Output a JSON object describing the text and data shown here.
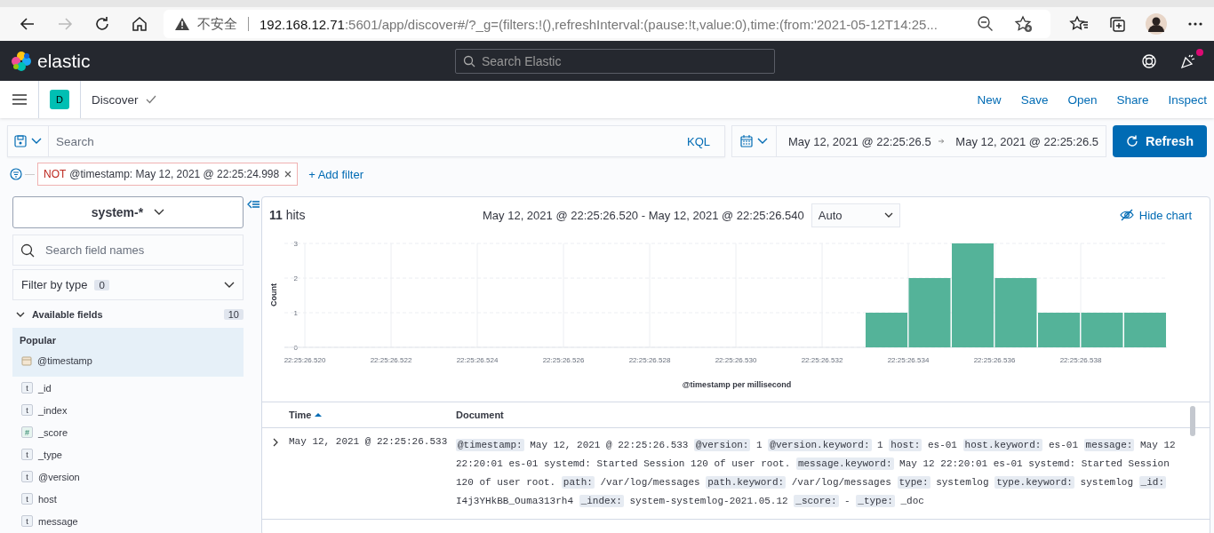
{
  "browser": {
    "security_label": "不安全",
    "address_host": "192.168.12.71",
    "address_rest": ":5601/app/discover#/?_g=(filters:!(),refreshInterval:(pause:!t,value:0),time:(from:'2021-05-12T14:25..."
  },
  "header": {
    "logo": "elastic",
    "search": {
      "placeholder": "Search Elastic"
    },
    "news_unread": true
  },
  "nav": {
    "space": "D",
    "breadcrumb": "Discover",
    "actions": [
      "New",
      "Save",
      "Open",
      "Share",
      "Inspect"
    ]
  },
  "query": {
    "placeholder": "Search",
    "language": "KQL",
    "time_start": "May 12, 2021 @ 22:25:26.5",
    "time_end": "May 12, 2021 @ 22:25:26.5",
    "refresh": "Refresh"
  },
  "filters": [
    {
      "negated": true,
      "prefix": "NOT",
      "label": "@timestamp: May 12, 2021 @ 22:25:24.998"
    }
  ],
  "add_filter": "+ Add filter",
  "sidebar": {
    "index_pattern": "system-*",
    "field_search": {
      "placeholder": "Search field names"
    },
    "filter_by_type": {
      "label": "Filter by type",
      "count": "0"
    },
    "available": {
      "label": "Available fields",
      "count": "10",
      "expanded": true
    },
    "popular": {
      "label": "Popular",
      "fields": [
        {
          "name": "@timestamp",
          "kind": "date"
        }
      ]
    },
    "fields": [
      {
        "name": "_id",
        "kind": "string",
        "badge": "t"
      },
      {
        "name": "_index",
        "kind": "string",
        "badge": "t"
      },
      {
        "name": "_score",
        "kind": "number",
        "badge": "#"
      },
      {
        "name": "_type",
        "kind": "string",
        "badge": "t"
      },
      {
        "name": "@version",
        "kind": "string",
        "badge": "t"
      },
      {
        "name": "host",
        "kind": "string",
        "badge": "t"
      },
      {
        "name": "message",
        "kind": "string",
        "badge": "t"
      }
    ]
  },
  "results": {
    "hits_count": "11",
    "hits_label": "hits",
    "range": "May 12, 2021 @ 22:25:26.520 - May 12, 2021 @ 22:25:26.540",
    "interval": "Auto",
    "hide_chart": "Hide chart",
    "chart_data": {
      "type": "bar",
      "xlabel": "@timestamp per millisecond",
      "ylabel": "Count",
      "categories": [
        "22:25:26.520",
        null,
        "22:25:26.522",
        null,
        "22:25:26.524",
        null,
        "22:25:26.526",
        null,
        "22:25:26.528",
        null,
        "22:25:26.530",
        null,
        "22:25:26.532",
        null,
        "22:25:26.534",
        null,
        "22:25:26.536",
        null,
        "22:25:26.538",
        null
      ],
      "grid": true,
      "series": [
        {
          "color": "#54b399",
          "values": [
            0,
            0,
            0,
            0,
            0,
            0,
            0,
            0,
            0,
            0,
            0,
            0,
            0,
            1,
            2,
            3,
            2,
            1,
            1,
            1
          ]
        }
      ],
      "ylim": [
        0,
        3
      ],
      "yticks": [
        0,
        1,
        2,
        3
      ]
    }
  },
  "table": {
    "columns": [
      {
        "label": "Time",
        "sorted": true
      },
      {
        "label": "Document",
        "sorted": false
      }
    ],
    "rows": [
      {
        "expanded": false,
        "time": "May 12, 2021 @ 22:25:26.533",
        "fields": [
          {
            "key": "@timestamp:",
            "value": "May 12, 2021 @ 22:25:26.533"
          },
          {
            "key": "@version:",
            "value": "1"
          },
          {
            "key": "@version.keyword:",
            "value": "1"
          },
          {
            "key": "host:",
            "value": "es-01"
          },
          {
            "key": "host.keyword:",
            "value": "es-01"
          },
          {
            "key": "message:",
            "value": "May 12 22:20:01 es-01 systemd: Started Session 120 of user root."
          },
          {
            "key": "message.keyword:",
            "value": "May 12 22:20:01 es-01 systemd: Started Session 120 of user root."
          },
          {
            "key": "path:",
            "value": "/var/log/messages"
          },
          {
            "key": "path.keyword:",
            "value": "/var/log/messages"
          },
          {
            "key": "type:",
            "value": "systemlog"
          },
          {
            "key": "type.keyword:",
            "value": "systemlog"
          },
          {
            "key": "_id:",
            "value": "I4j3YHkBB_Ouma313rh4"
          },
          {
            "key": "_index:",
            "value": "system-systemlog-2021.05.12"
          },
          {
            "key": "_score:",
            "value": " - "
          },
          {
            "key": "_type:",
            "value": "_doc"
          }
        ]
      }
    ]
  }
}
